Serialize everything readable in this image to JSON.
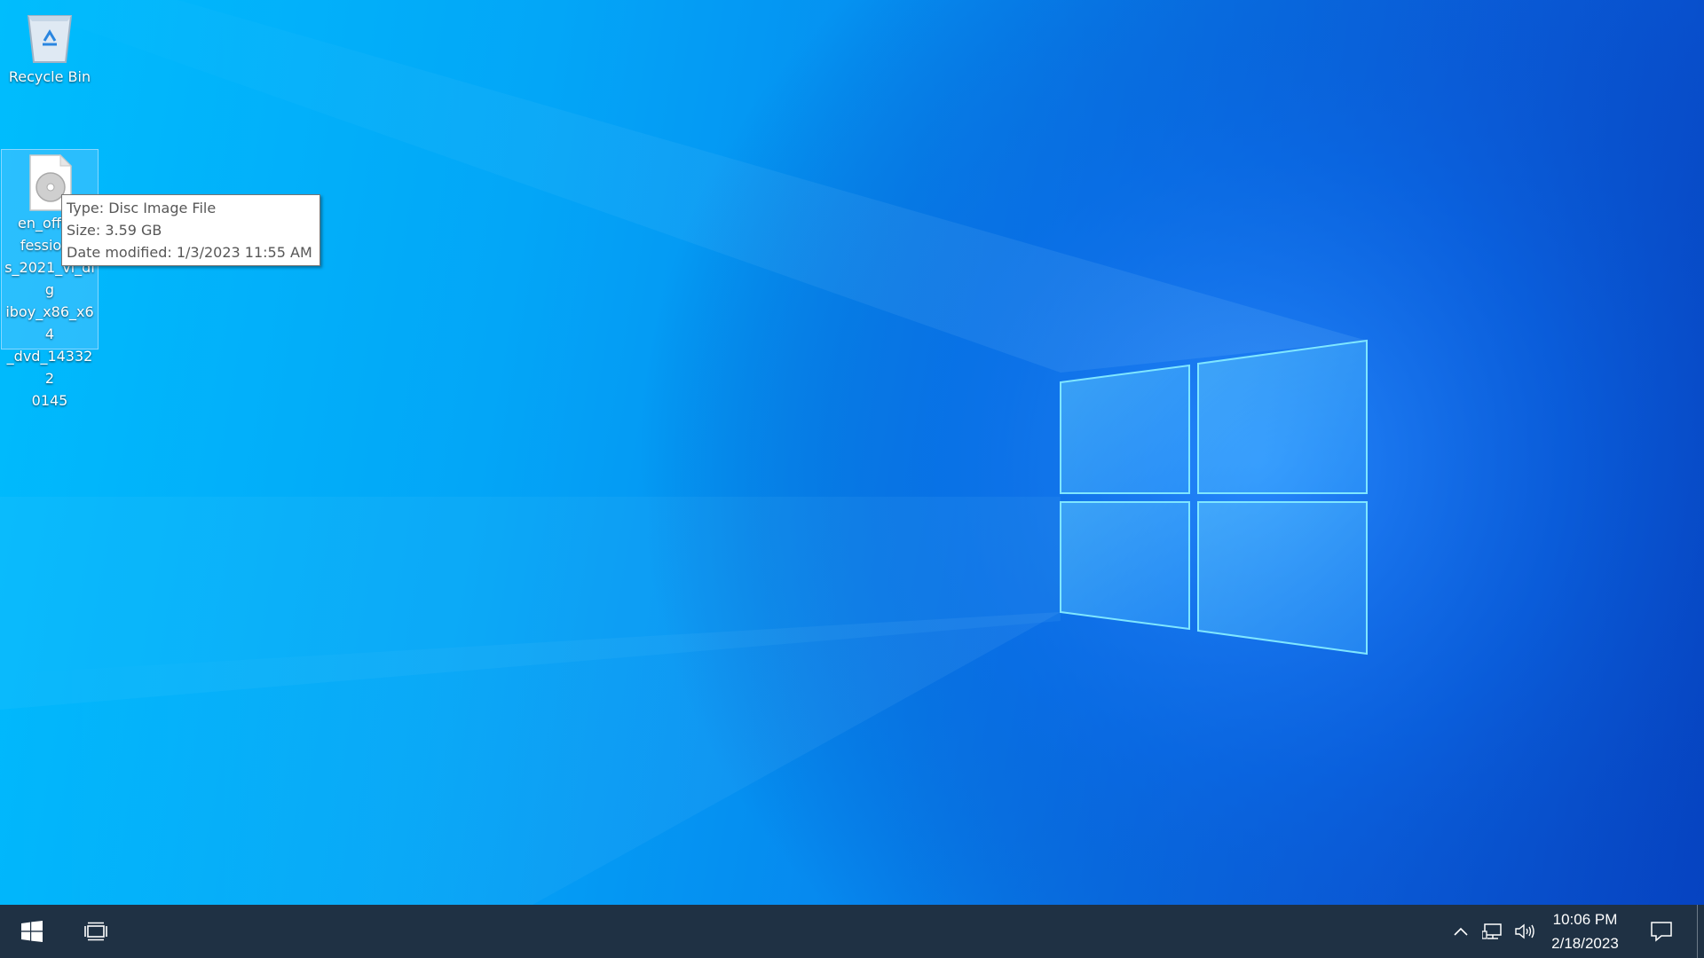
{
  "desktop": {
    "icons": [
      {
        "label": "Recycle Bin",
        "icon": "recycle-bin-icon"
      },
      {
        "label": "en_office_professional_plus_2021_vl_digiboy_x86_x64_dvd_1433220145",
        "visible_label_lines": [
          "en_office",
          "fessiona",
          "s_2021_vl_dig",
          "iboy_x86_x64",
          "_dvd_143322",
          "0145"
        ],
        "icon": "disc-image-icon"
      }
    ],
    "tooltip": {
      "type": "Type: Disc Image File",
      "size": "Size: 3.59 GB",
      "modified": "Date modified: 1/3/2023 11:55 AM"
    }
  },
  "taskbar": {
    "start_icon": "windows-logo-icon",
    "task_view_icon": "task-view-icon",
    "tray": {
      "chevron_icon": "chevron-up-icon",
      "network_icon": "network-icon",
      "volume_icon": "speaker-icon"
    },
    "clock": {
      "time": "10:06 PM",
      "date": "2/18/2023"
    },
    "action_center_icon": "notification-icon"
  },
  "colors": {
    "taskbar": "#1f3144",
    "wallpaper_accent": "#0a78f0"
  }
}
